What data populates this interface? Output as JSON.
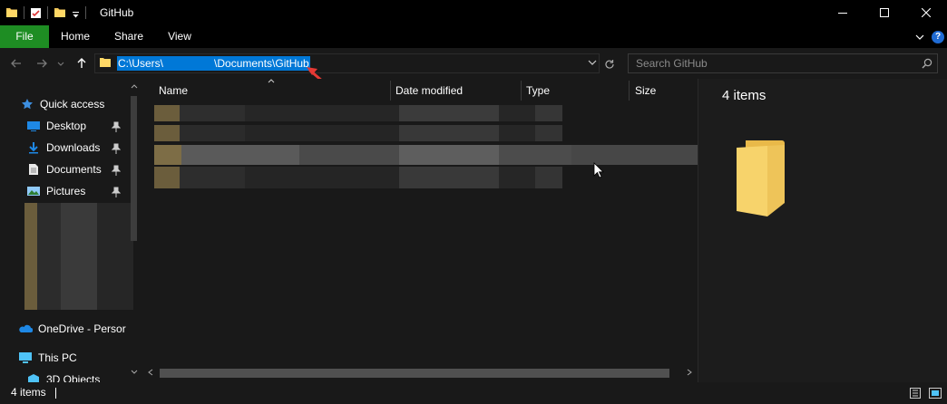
{
  "window": {
    "title": "GitHub",
    "quick_access_toolbar": [
      "folder-icon",
      "properties-icon",
      "new-folder-icon",
      "customize-dropdown-icon"
    ],
    "controls": [
      "minimize",
      "maximize",
      "close"
    ]
  },
  "ribbon": {
    "tabs": [
      {
        "label": "File",
        "active": true,
        "color": "#1e8d23"
      },
      {
        "label": "Home"
      },
      {
        "label": "Share"
      },
      {
        "label": "View"
      }
    ]
  },
  "navbar": {
    "address": "C:\\Users\\[redacted]\\Documents\\GitHub",
    "address_shown": "C:\\Users\\",
    "address_suffix": "\\Documents\\GitHub",
    "search_placeholder": "Search GitHub"
  },
  "navigation_pane": {
    "items": [
      {
        "label": "Quick access",
        "icon": "star-icon"
      },
      {
        "label": "Desktop",
        "icon": "desktop-icon",
        "pinned": true
      },
      {
        "label": "Downloads",
        "icon": "download-icon",
        "pinned": true
      },
      {
        "label": "Documents",
        "icon": "documents-icon",
        "pinned": true
      },
      {
        "label": "Pictures",
        "icon": "pictures-icon",
        "pinned": true
      },
      {
        "label": "OneDrive - Persor",
        "icon": "onedrive-icon"
      },
      {
        "label": "This PC",
        "icon": "pc-icon"
      },
      {
        "label": "3D Objects",
        "icon": "3d-objects-icon"
      }
    ]
  },
  "file_list": {
    "columns": [
      "Name",
      "Date modified",
      "Type",
      "Size"
    ],
    "sort_indicator": "up",
    "rows_blurred": 4
  },
  "preview": {
    "title": "4 items"
  },
  "status": {
    "text": "4 items"
  },
  "colors": {
    "accent_file_tab": "#1e8d23",
    "selection": "#0078d7",
    "background": "#191919"
  }
}
